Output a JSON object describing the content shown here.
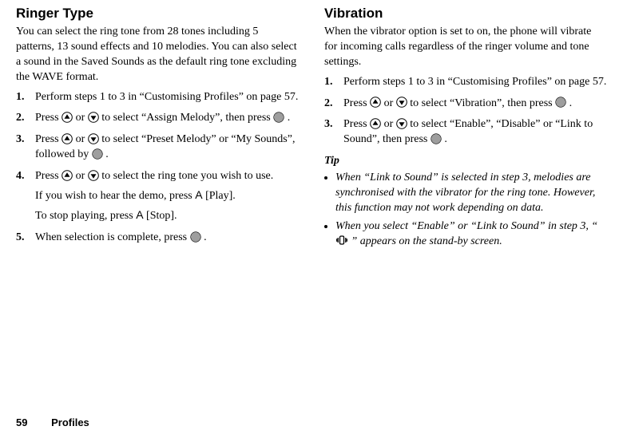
{
  "left": {
    "title": "Ringer Type",
    "intro": "You can select the ring tone from 28 tones including 5 patterns, 13 sound effects and 10 melodies. You can also select a sound in the Saved Sounds as the default ring tone excluding the WAVE format.",
    "step1": "Perform steps 1 to 3 in “Customising Profiles” on page 57.",
    "step2a": "Press ",
    "step2b": " or ",
    "step2c": " to select “Assign Melody”, then press ",
    "step2d": ".",
    "step3a": "Press ",
    "step3b": " or ",
    "step3c": " to select “Preset Melody” or “My Sounds”, followed by ",
    "step3d": ".",
    "step4a": "Press ",
    "step4b": " or ",
    "step4c": " to select the ring tone you wish to use.",
    "step4sub1a": "If you wish to hear the demo, press ",
    "step4sub1b": " [Play].",
    "step4sub2a": "To stop playing, press ",
    "step4sub2b": " [Stop].",
    "softkey": "A",
    "step5a": "When selection is complete, press ",
    "step5b": "."
  },
  "right": {
    "title": "Vibration",
    "intro": "When the vibrator option is set to on, the phone will vibrate for incoming calls regardless of the ringer volume and tone settings.",
    "step1": "Perform steps 1 to 3 in “Customising Profiles” on page 57.",
    "step2a": "Press ",
    "step2b": " or ",
    "step2c": " to select “Vibration”, then press ",
    "step2d": ".",
    "step3a": "Press ",
    "step3b": " or ",
    "step3c": " to select “Enable”, “Disable” or “Link to Sound”, then press ",
    "step3d": ".",
    "tip_heading": "Tip",
    "tip1": "When “Link to Sound” is selected in step 3, melodies are synchronised with the vibrator for the ring tone. However, this function may not work depending on data.",
    "tip2a": "When you select “Enable” or “Link to Sound” in step 3, “",
    "tip2b": "” appears on the stand-by screen."
  },
  "footer": {
    "page": "59",
    "section": "Profiles"
  }
}
